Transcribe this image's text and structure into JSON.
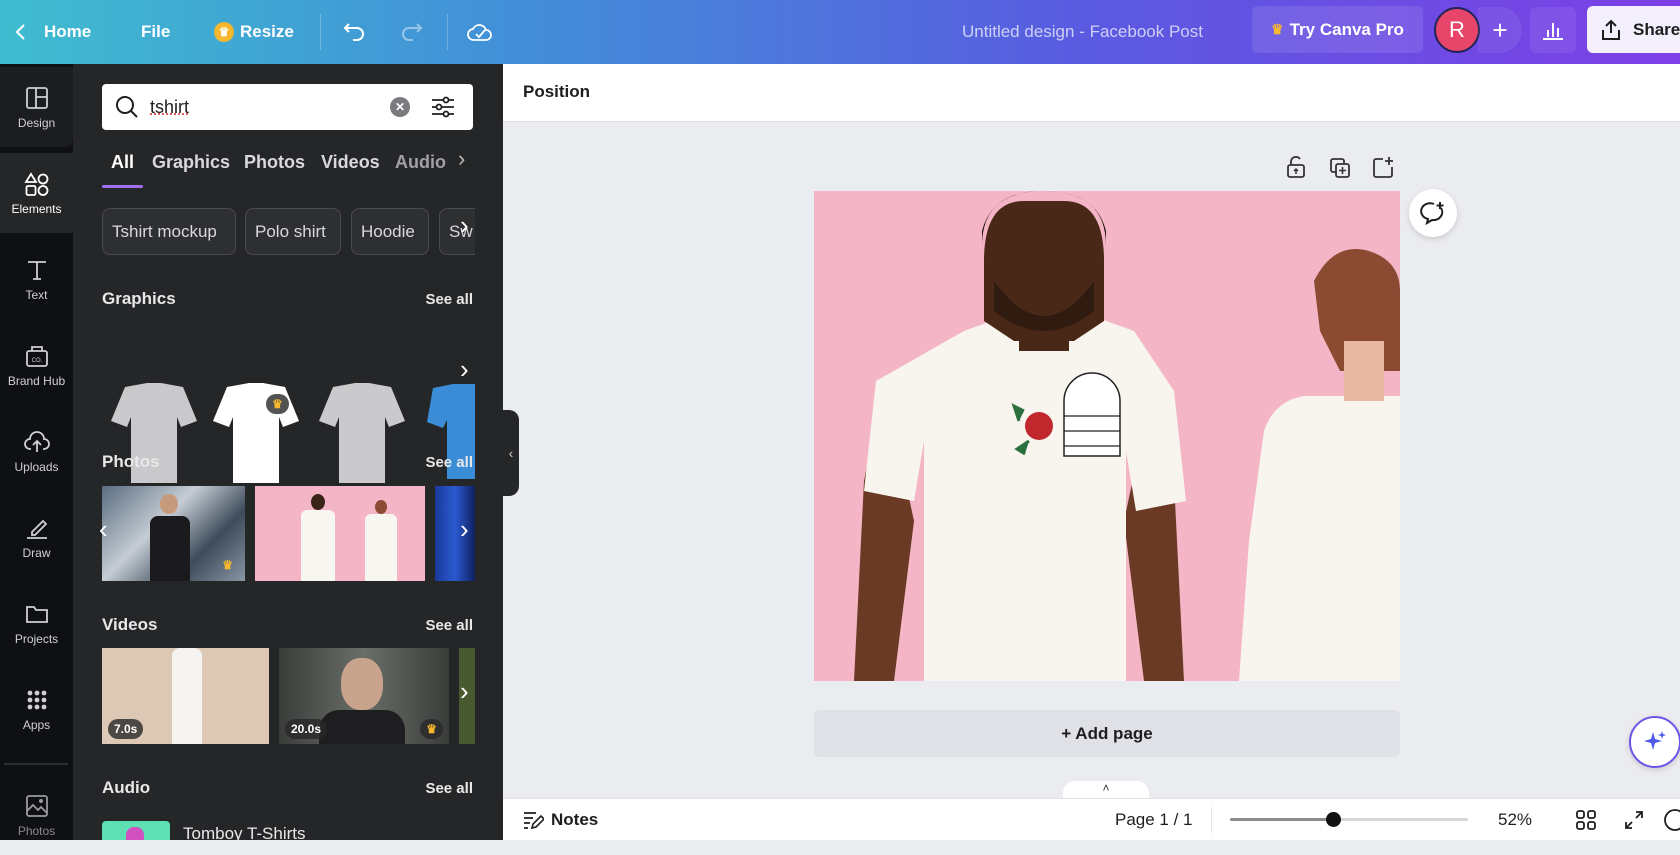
{
  "topbar": {
    "home": "Home",
    "file": "File",
    "resize": "Resize",
    "title": "Untitled design - Facebook Post",
    "try_pro": "Try Canva Pro",
    "avatar_initial": "R",
    "share": "Share"
  },
  "rail": [
    {
      "label": "Design",
      "icon": "layout-icon"
    },
    {
      "label": "Elements",
      "icon": "shapes-icon"
    },
    {
      "label": "Text",
      "icon": "text-icon"
    },
    {
      "label": "Brand Hub",
      "icon": "brand-icon"
    },
    {
      "label": "Uploads",
      "icon": "cloud-upload-icon"
    },
    {
      "label": "Draw",
      "icon": "pen-icon"
    },
    {
      "label": "Projects",
      "icon": "folder-icon"
    },
    {
      "label": "Apps",
      "icon": "grid-icon"
    },
    {
      "label": "Photos",
      "icon": "image-icon"
    }
  ],
  "panel": {
    "search": {
      "value": "tshirt"
    },
    "tabs": [
      "All",
      "Graphics",
      "Photos",
      "Videos",
      "Audio"
    ],
    "chips": [
      "Tshirt mockup",
      "Polo shirt",
      "Hoodie",
      "Sw"
    ],
    "sections": {
      "graphics": "Graphics",
      "photos": "Photos",
      "videos": "Videos",
      "audio": "Audio"
    },
    "see_all": "See all",
    "videos": [
      {
        "duration": "7.0s"
      },
      {
        "duration": "20.0s"
      }
    ],
    "audio_track": "Tomboy T-Shirts"
  },
  "canvas": {
    "toolbar_label": "Position",
    "add_page": "+ Add page"
  },
  "bottombar": {
    "notes": "Notes",
    "page": "Page 1 / 1",
    "zoom": "52%",
    "zoom_level": 52
  },
  "colors": {
    "accent": "#8b3dff",
    "page_bg": "#f4b6c6",
    "panel_bg": "#252627"
  }
}
